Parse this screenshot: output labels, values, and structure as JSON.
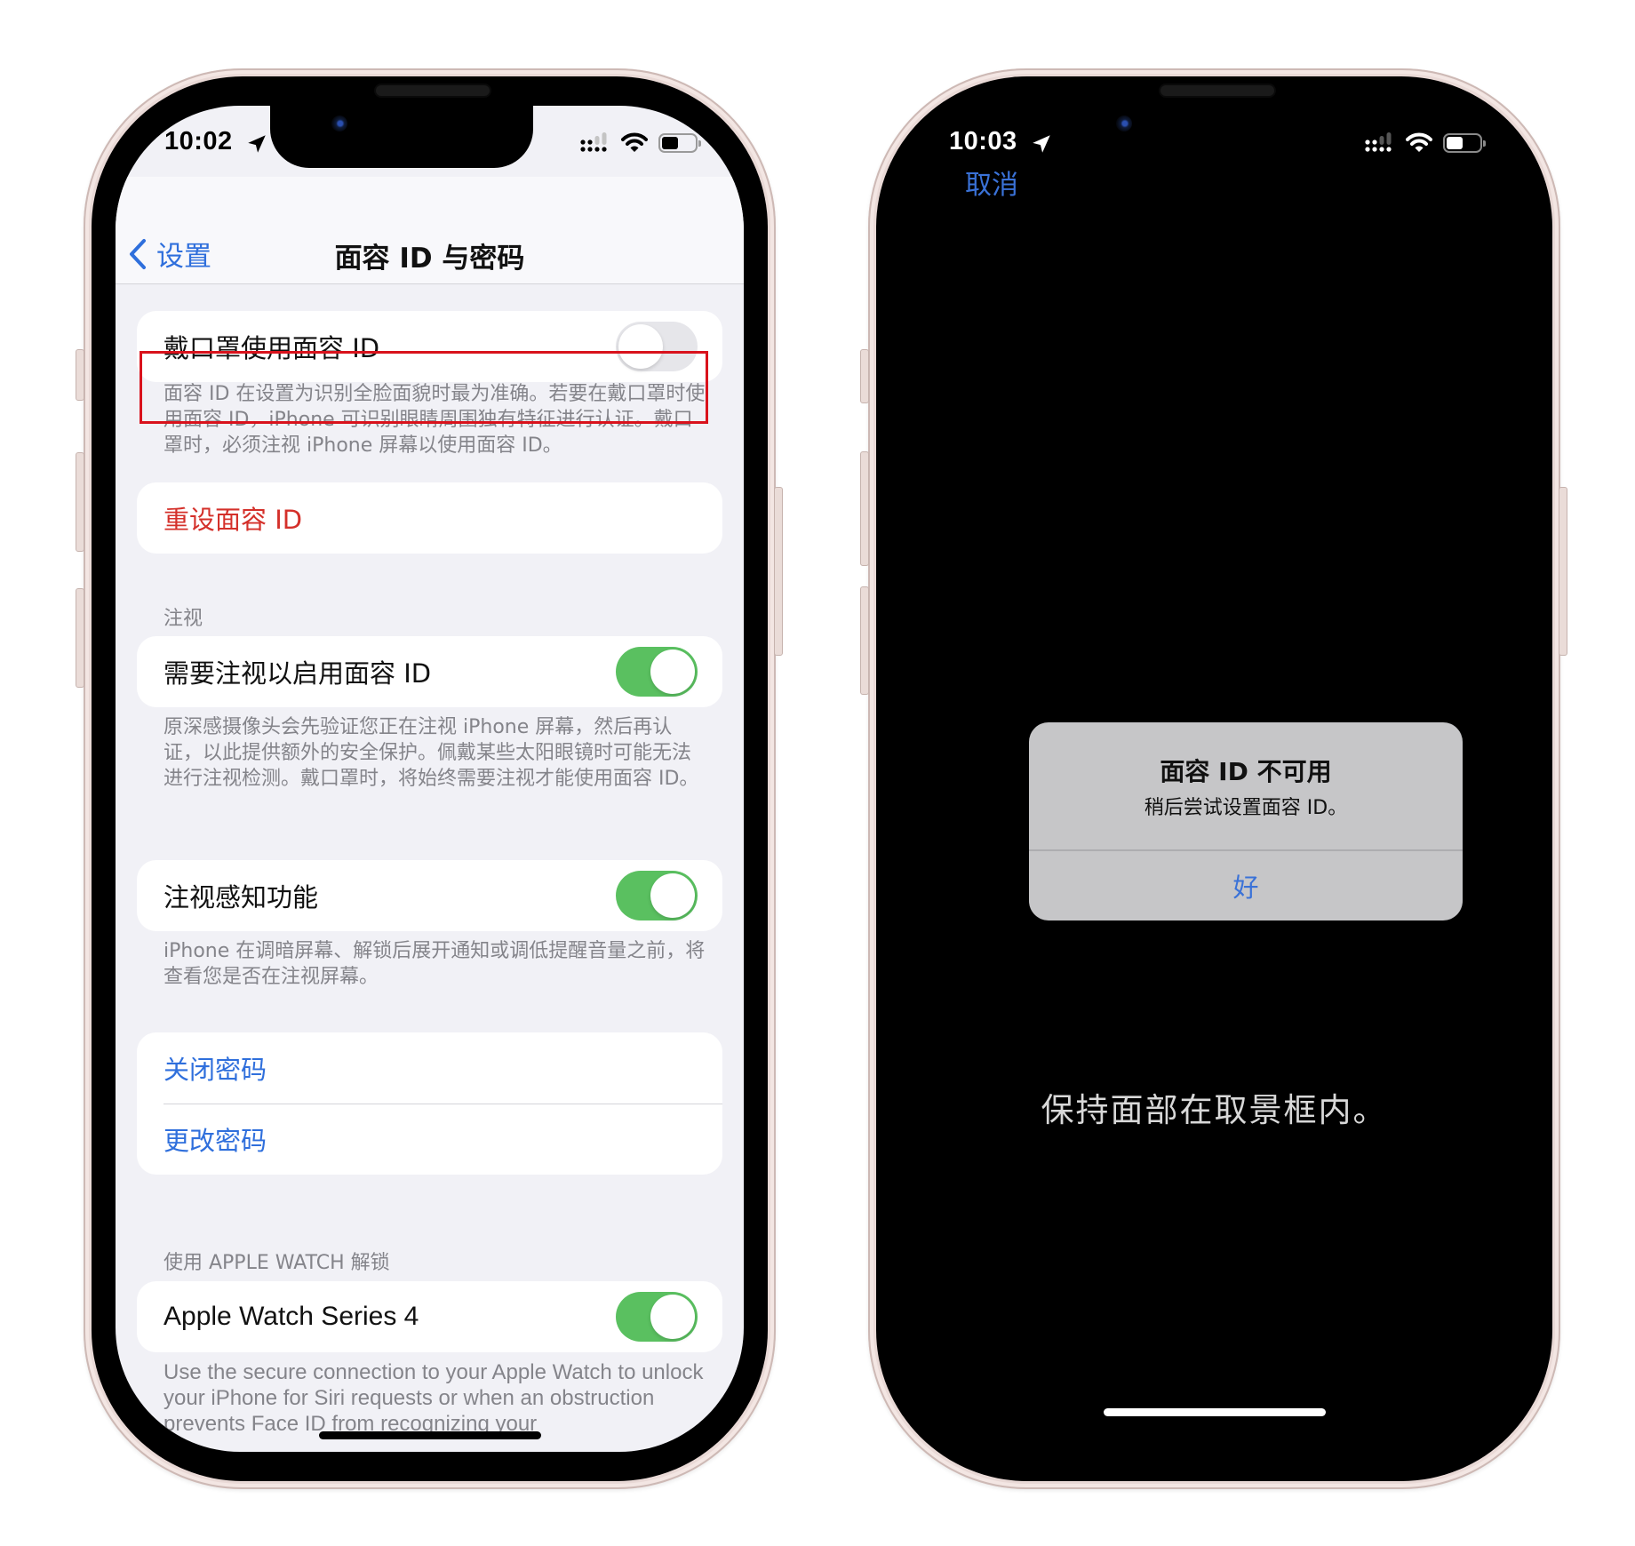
{
  "left_phone": {
    "status_bar": {
      "time": "10:02",
      "battery_level": 0.5
    },
    "nav": {
      "back_label": "设置",
      "title": "面容 ID 与密码"
    },
    "mask_row": {
      "label": "戴口罩使用面容 ID",
      "toggle_on": false
    },
    "mask_footnote": "面容 ID 在设置为识别全脸面貌时最为准确。若要在戴口罩时使用面容 ID，iPhone 可识别眼睛周围独有特征进行认证。戴口罩时，必须注视 iPhone 屏幕以使用面容 ID。",
    "reset_face_id": "重设面容 ID",
    "attention_section": {
      "header": "注视",
      "require_attention": {
        "label": "需要注视以启用面容 ID",
        "toggle_on": true
      },
      "require_footnote": "原深感摄像头会先验证您正在注视 iPhone 屏幕，然后再认证，以此提供额外的安全保护。佩戴某些太阳眼镜时可能无法进行注视检测。戴口罩时，将始终需要注视才能使用面容 ID。",
      "aware_features": {
        "label": "注视感知功能",
        "toggle_on": true
      },
      "aware_footnote": "iPhone 在调暗屏幕、解锁后展开通知或调低提醒音量之前，将查看您是否在注视屏幕。"
    },
    "passcode": {
      "turn_off": "关闭密码",
      "change": "更改密码"
    },
    "watch_section": {
      "header": "使用 APPLE WATCH 解锁",
      "watch": {
        "label": "Apple Watch Series 4",
        "toggle_on": true
      },
      "footnote": "Use the secure connection to your Apple Watch to unlock your iPhone for Siri requests or when an obstruction prevents Face ID from recognizing your"
    }
  },
  "right_phone": {
    "status_bar": {
      "time": "10:03",
      "battery_level": 0.5
    },
    "cancel_label": "取消",
    "alert": {
      "title": "面容 ID 不可用",
      "message": "稍后尝试设置面容 ID。",
      "ok_label": "好"
    },
    "hint": "保持面部在取景框内。"
  },
  "colors": {
    "accent_blue": "#2f6fdc",
    "destructive_red": "#d4302a",
    "toggle_green": "#5ac060",
    "highlight_red": "#d9121c",
    "alert_bg": "#c6c6c8"
  }
}
